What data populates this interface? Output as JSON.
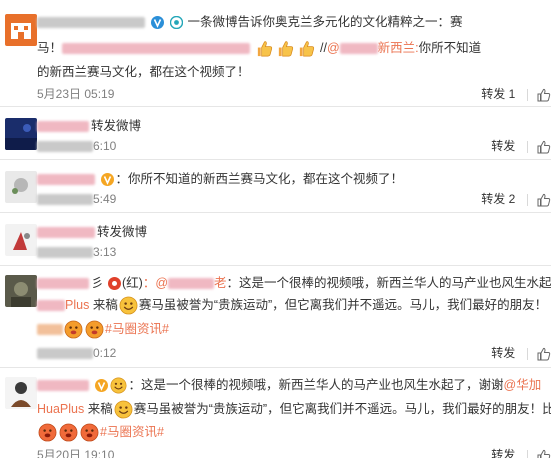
{
  "feed": {
    "items": [
      {
        "line1_text": "一条微博告诉你奥克兰多元化的文化精粹之一：赛",
        "line2_prefix": "马！",
        "line2_sep": "//",
        "line2_mention_end": "新西兰:",
        "line2_text": "你所不知道",
        "line3_text": "的新西兰赛马文化，都在这个视频了！",
        "time": "5月23日 05:19",
        "repost_label": "转发",
        "repost_count": "1"
      },
      {
        "text": "转发微博",
        "time": "6:10",
        "repost_label": "转发"
      },
      {
        "text": "：你所不知道的新西兰赛马文化，都在这个视频了！",
        "time": "5:49",
        "repost_label": "转发",
        "repost_count": "2"
      },
      {
        "text": "转发微博",
        "time": "3:13",
        "repost_label": "转发"
      },
      {
        "prefix": "彡",
        "red_tag": "(红)",
        "mention_start": "：@",
        "mention_end": "老",
        "line1_text": "：这是一个很棒的视频哦，新西兰华人的马产业也风生水起了，谢谢@",
        "line2_link": "Plus",
        "line2_text_a": "来稿",
        "line2_text_b": "赛马虽被誉为“贵族运动”，但它离我们并不遥远。马儿，我们最好的朋友！",
        "topic": "#马圈资讯#",
        "time": "0:12",
        "repost_label": "转发"
      },
      {
        "line1_text": "：这是一个很棒的视频哦，新西兰华人的马产业也风生水起了，谢谢",
        "line1_mention": "@华加",
        "line2_link": "HuaPlus",
        "line2_text_a": "来稿",
        "line2_text_b": "赛马虽被誉为“贵族运动”，但它离我们并不遥远。马儿，我们最好的朋友！比心",
        "topic": "#马圈资讯#",
        "time": "5月20日 19:10",
        "repost_label": "转发"
      }
    ]
  },
  "colors": {
    "link": "#eb7350",
    "text": "#333333",
    "meta": "#808080",
    "divider": "#e6e6e6"
  },
  "icons": [
    "thumbs-up-emoji",
    "smile-emoji",
    "verified-badge-icon",
    "like-icon"
  ]
}
